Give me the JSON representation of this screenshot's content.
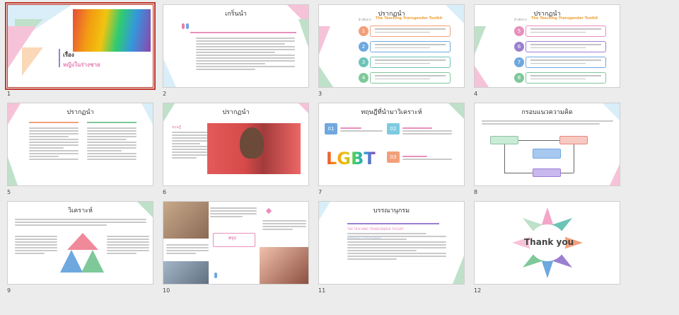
{
  "slides": [
    {
      "number": "1",
      "title": "เรื่อง",
      "subtitle": "หญิงในร่างชาย",
      "selected": true
    },
    {
      "number": "2",
      "title": "เกริ่นนำ"
    },
    {
      "number": "3",
      "title": "ปรากฏนำ",
      "subtitle_prefix": "อ้างอิงจาก",
      "source": "The Teaching Transgender Toolkit",
      "items": [
        "1",
        "2",
        "3",
        "4"
      ]
    },
    {
      "number": "4",
      "title": "ปรากฏนำ",
      "subtitle_prefix": "อ้างอิงจาก",
      "source": "The Teaching Transgender Toolkit",
      "items": [
        "5",
        "6",
        "7",
        "8"
      ]
    },
    {
      "number": "5",
      "title": "ปรากฏนำ"
    },
    {
      "number": "6",
      "title": "ปรากฏนำ",
      "caption": "ทฤษฎี"
    },
    {
      "number": "7",
      "title": "ทฤษฎีที่นำมาวิเคราะห์",
      "steps": [
        "01",
        "02",
        "03"
      ],
      "logo": "LGBT"
    },
    {
      "number": "8",
      "title": "กรอบแนวความคิด"
    },
    {
      "number": "9",
      "title": "วิเคราะห์"
    },
    {
      "number": "10",
      "title": "สรุป"
    },
    {
      "number": "11",
      "title": "บรรณานุกรม",
      "refs": [
        "THE TEACHING TRANSGENDER TOOLKIT",
        "NATIONAL GEOGRAPHIC"
      ]
    },
    {
      "number": "12",
      "title": "Thank you"
    }
  ],
  "colors": {
    "accent": "#c0392b",
    "pink": "#f3a6c8",
    "teal": "#6cc4b7",
    "purple": "#9a7fd1",
    "blue": "#6ea8de",
    "green": "#7fc89a",
    "orange": "#f2a07a"
  }
}
